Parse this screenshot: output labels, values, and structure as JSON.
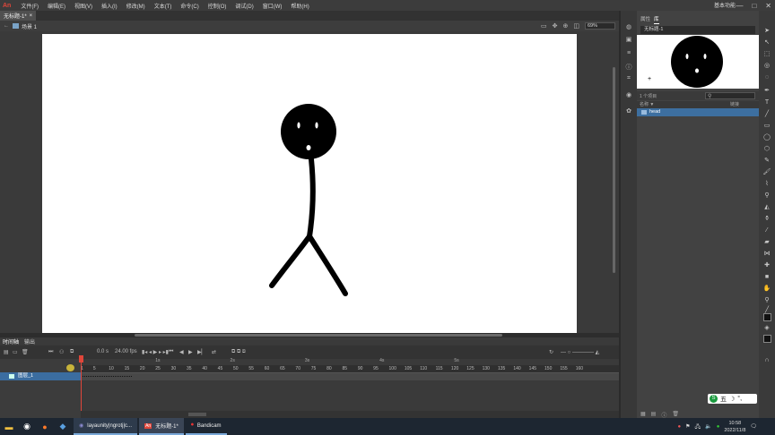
{
  "app": {
    "logo": "An"
  },
  "menus": [
    "文件(F)",
    "编辑(E)",
    "视图(V)",
    "插入(I)",
    "修改(M)",
    "文本(T)",
    "命令(C)",
    "控制(O)",
    "调试(D)",
    "窗口(W)",
    "帮助(H)"
  ],
  "workspace": "基本功能",
  "window_buttons": [
    "—",
    "□",
    "✕"
  ],
  "document_tab": {
    "title": "无标题-1*",
    "close": "×"
  },
  "edit_bar": {
    "back": "←",
    "scene": "场景 1",
    "zoom": "69%"
  },
  "library": {
    "tabs": [
      "属性",
      "库"
    ],
    "document": "无标题-1",
    "count": "1 个项目",
    "column": "名称 ▼",
    "column2": "链接",
    "items": [
      "head"
    ]
  },
  "timeline": {
    "tabs": [
      "时间轴",
      "输出"
    ],
    "frame_value": "0.0 s",
    "fps": "24.00 fps",
    "layer": "图层_1",
    "ruler": [
      "1",
      "5",
      "10",
      "15",
      "20",
      "25",
      "30",
      "35",
      "40",
      "45",
      "50",
      "55",
      "60",
      "65",
      "70",
      "75",
      "80",
      "85",
      "90",
      "95",
      "100",
      "105",
      "110",
      "115",
      "120",
      "125",
      "130",
      "135",
      "140",
      "145",
      "150",
      "155",
      "160"
    ],
    "seconds": [
      "1s",
      "2s",
      "3s",
      "4s",
      "5s"
    ]
  },
  "taskbar": {
    "apps": [
      "layaunity|ngrotj|c...",
      "无标题-1*",
      "Bandicam"
    ],
    "time": "10:58",
    "date": "2022/11/8"
  },
  "ime": {
    "label": "五"
  },
  "colors": {
    "accent": "#e0463a",
    "selection": "#3b6da0"
  }
}
